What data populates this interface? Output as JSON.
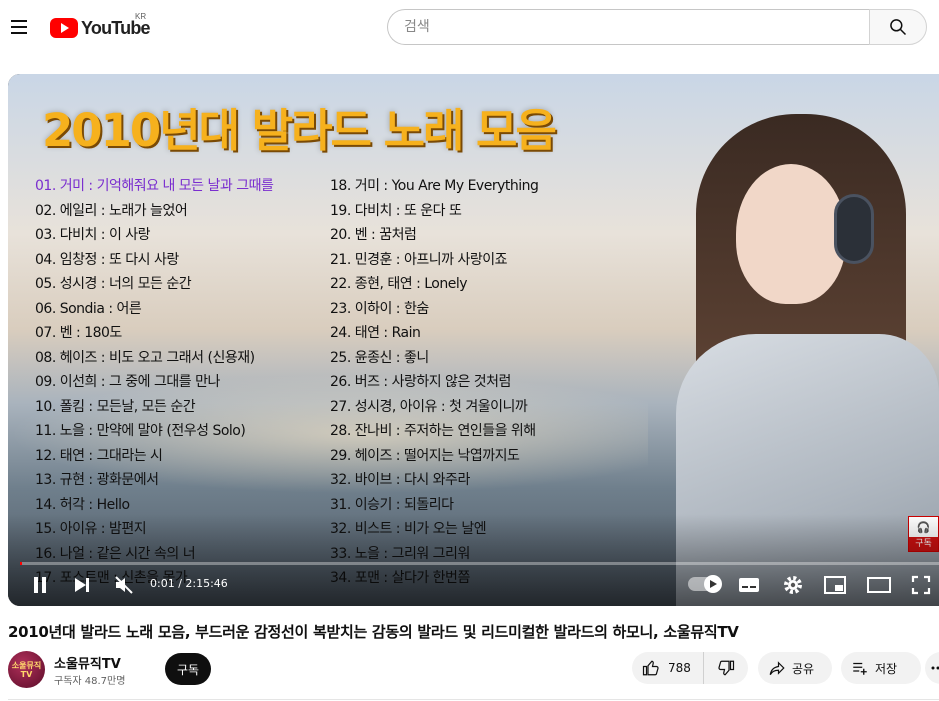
{
  "header": {
    "logo_text": "YouTube",
    "country_code": "KR",
    "search_placeholder": "검색"
  },
  "thumbnail": {
    "title": "2010년대 발라드 노래 모음",
    "songs_left": [
      "01. 거미 : 기억해줘요 내 모든 날과 그때를",
      "02. 에일리 : 노래가 늘었어",
      "03. 다비치 : 이 사랑",
      "04. 임창정 : 또 다시 사랑",
      "05. 성시경 : 너의 모든 순간",
      "06. Sondia : 어른",
      "07. 벤 : 180도",
      "08. 헤이즈 : 비도 오고 그래서 (신용재)",
      "09. 이선희 : 그 중에 그대를 만나",
      "10. 폴킴 : 모든날, 모든 순간",
      "11. 노을 : 만약에 말야 (전우성 Solo)",
      "12. 태연 : 그대라는 시",
      "13. 규현 : 광화문에서",
      "14. 허각 : Hello",
      "15. 아이유 : 밤편지",
      "16. 나얼 : 같은 시간 속의 너",
      "17. 포스트맨 : 신촌을 못가"
    ],
    "songs_right": [
      "18. 거미 : You Are My Everything",
      "19. 다비치 : 또 운다 또",
      "20. 벤 : 꿈처럼",
      "21. 민경훈 : 아프니까 사랑이죠",
      "22. 종현, 태연 : Lonely",
      "23. 이하이 : 한숨",
      "24. 태연 : Rain",
      "25. 윤종신 : 좋니",
      "26. 버즈 : 사랑하지 않은 것처럼",
      "27. 성시경, 아이유 : 첫 겨울이니까",
      "28. 잔나비 : 주저하는 연인들을 위해",
      "29. 헤이즈 : 떨어지는 낙엽까지도",
      "32. 바이브 : 다시 와주라",
      "31. 이승기 : 되돌리다",
      "32. 비스트 : 비가 오는 날엔",
      "33. 노을 : 그리워 그리워",
      "34. 포맨 : 살다가 한번쯤"
    ],
    "badge_label": "구독"
  },
  "player": {
    "time_display": "0:01 / 2:15:46",
    "progress_fraction": 0.0001
  },
  "video": {
    "title": "2010년대 발라드 노래 모음, 부드러운 감정선이 복받치는 감동의 발라드 및 리드미컬한 발라드의 하모니, 소울뮤직TV"
  },
  "channel": {
    "avatar_text": "소울뮤직 TV",
    "name": "소울뮤직TV",
    "subscribers": "구독자 48.7만명",
    "subscribe_label": "구독"
  },
  "actions": {
    "like_count": "788",
    "share_label": "공유",
    "save_label": "저장"
  }
}
